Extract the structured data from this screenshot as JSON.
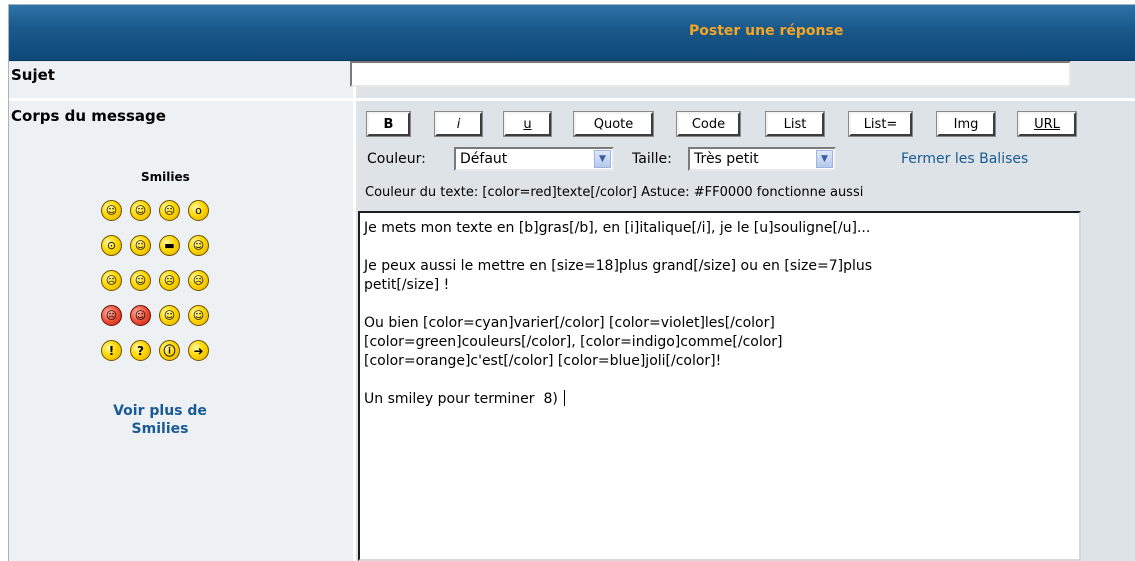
{
  "header": {
    "title": "Poster une réponse"
  },
  "subject": {
    "label": "Sujet",
    "value": ""
  },
  "body": {
    "label": "Corps du message"
  },
  "smilies": {
    "title": "Smilies",
    "more_label": "Voir plus de Smilies",
    "items": [
      {
        "name": "very-happy-smiley-icon",
        "glyph": "☺"
      },
      {
        "name": "smile-smiley-icon",
        "glyph": "☺"
      },
      {
        "name": "sad-smiley-icon",
        "glyph": "☹"
      },
      {
        "name": "surprised-smiley-icon",
        "glyph": "o"
      },
      {
        "name": "shocked-smiley-icon",
        "glyph": "⊙"
      },
      {
        "name": "confused-smiley-icon",
        "glyph": "☺"
      },
      {
        "name": "cool-smiley-icon",
        "glyph": "▬"
      },
      {
        "name": "laughing-smiley-icon",
        "glyph": "☺"
      },
      {
        "name": "mad-smiley-icon",
        "glyph": "☹"
      },
      {
        "name": "razz-smiley-icon",
        "glyph": "☺"
      },
      {
        "name": "embarrassed-smiley-icon",
        "glyph": "☹"
      },
      {
        "name": "crying-smiley-icon",
        "glyph": "☹"
      },
      {
        "name": "evil-smiley-icon",
        "glyph": "☹",
        "red": true
      },
      {
        "name": "twisted-evil-smiley-icon",
        "glyph": "☺",
        "red": true
      },
      {
        "name": "rolling-eyes-smiley-icon",
        "glyph": "☺"
      },
      {
        "name": "wink-smiley-icon",
        "glyph": "☺"
      },
      {
        "name": "exclamation-smiley-icon",
        "glyph": "!"
      },
      {
        "name": "question-smiley-icon",
        "glyph": "?"
      },
      {
        "name": "idea-smiley-icon",
        "glyph": "ⓘ"
      },
      {
        "name": "arrow-smiley-icon",
        "glyph": "➜"
      }
    ]
  },
  "toolbar": {
    "bold": "B",
    "italic": "i",
    "underline": "u",
    "quote": "Quote",
    "code": "Code",
    "list": "List",
    "list_eq": "List=",
    "img": "Img",
    "url": "URL"
  },
  "format": {
    "color_label": "Couleur:",
    "color_value": "Défaut",
    "size_label": "Taille:",
    "size_value": "Très petit",
    "close_tags": "Fermer les Balises",
    "help": "Couleur du texte: [color=red]texte[/color] Astuce: #FF0000 fonctionne aussi"
  },
  "message": {
    "text": "Je mets mon texte en [b]gras[/b], en [i]italique[/i], je le [u]souligne[/u]...\n\nJe peux aussi le mettre en [size=18]plus grand[/size] ou en [size=7]plus\npetit[/size] !\n\nOu bien [color=cyan]varier[/color] [color=violet]les[/color]\n[color=green]couleurs[/color], [color=indigo]comme[/color]\n[color=orange]c'est[/color] [color=blue]joli[/color]!\n\nUn smiley pour terminer  8) "
  }
}
